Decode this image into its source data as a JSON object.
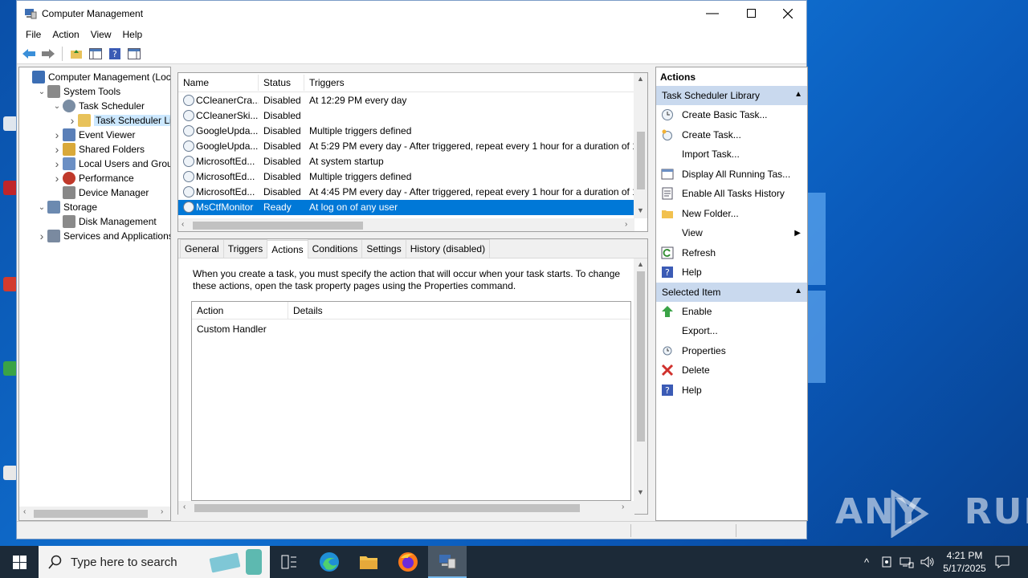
{
  "window": {
    "title": "Computer Management"
  },
  "menu": [
    "File",
    "Action",
    "View",
    "Help"
  ],
  "tree": [
    {
      "label": "Computer Management (Local",
      "icon": "computer-management-icon",
      "exp": "",
      "indent": 0
    },
    {
      "label": "System Tools",
      "icon": "tools-icon",
      "exp": "v",
      "indent": 1
    },
    {
      "label": "Task Scheduler",
      "icon": "clock-icon",
      "exp": "v",
      "indent": 2
    },
    {
      "label": "Task Scheduler Libra",
      "icon": "folder-clock-icon",
      "exp": ">",
      "indent": 3,
      "selected": true
    },
    {
      "label": "Event Viewer",
      "icon": "event-viewer-icon",
      "exp": ">",
      "indent": 2
    },
    {
      "label": "Shared Folders",
      "icon": "shared-folders-icon",
      "exp": ">",
      "indent": 2
    },
    {
      "label": "Local Users and Groups",
      "icon": "users-icon",
      "exp": ">",
      "indent": 2
    },
    {
      "label": "Performance",
      "icon": "performance-icon",
      "exp": ">",
      "indent": 2
    },
    {
      "label": "Device Manager",
      "icon": "device-manager-icon",
      "exp": "",
      "indent": 2
    },
    {
      "label": "Storage",
      "icon": "storage-icon",
      "exp": "v",
      "indent": 1
    },
    {
      "label": "Disk Management",
      "icon": "disk-icon",
      "exp": "",
      "indent": 2
    },
    {
      "label": "Services and Applications",
      "icon": "services-icon",
      "exp": ">",
      "indent": 1
    }
  ],
  "task_list": {
    "columns": [
      "Name",
      "Status",
      "Triggers"
    ],
    "rows": [
      {
        "name": "CCleanerCra...",
        "status": "Disabled",
        "triggers": "At 12:29 PM every day"
      },
      {
        "name": "CCleanerSki...",
        "status": "Disabled",
        "triggers": ""
      },
      {
        "name": "GoogleUpda...",
        "status": "Disabled",
        "triggers": "Multiple triggers defined"
      },
      {
        "name": "GoogleUpda...",
        "status": "Disabled",
        "triggers": "At 5:29 PM every day - After triggered, repeat every 1 hour for a duration of 1"
      },
      {
        "name": "MicrosoftEd...",
        "status": "Disabled",
        "triggers": "At system startup"
      },
      {
        "name": "MicrosoftEd...",
        "status": "Disabled",
        "triggers": "Multiple triggers defined"
      },
      {
        "name": "MicrosoftEd...",
        "status": "Disabled",
        "triggers": "At 4:45 PM every day - After triggered, repeat every 1 hour for a duration of 1"
      },
      {
        "name": "MsCtfMonitor",
        "status": "Ready",
        "triggers": "At log on of any user",
        "selected": true
      }
    ]
  },
  "detail": {
    "tabs": [
      "General",
      "Triggers",
      "Actions",
      "Conditions",
      "Settings",
      "History (disabled)"
    ],
    "active_tab": "Actions",
    "description": "When you create a task, you must specify the action that will occur when your task starts.  To change these actions, open the task property pages using the Properties command.",
    "columns": [
      "Action",
      "Details"
    ],
    "rows": [
      {
        "action": "Custom Handler",
        "details": ""
      }
    ]
  },
  "actions_pane": {
    "title": "Actions",
    "section1": {
      "header": "Task Scheduler Library",
      "items": [
        {
          "label": "Create Basic Task...",
          "icon": "create-basic-task-icon"
        },
        {
          "label": "Create Task...",
          "icon": "create-task-icon"
        },
        {
          "label": "Import Task...",
          "icon": ""
        },
        {
          "label": "Display All Running Tas...",
          "icon": "running-tasks-icon"
        },
        {
          "label": "Enable All Tasks History",
          "icon": "history-icon"
        },
        {
          "label": "New Folder...",
          "icon": "new-folder-icon"
        },
        {
          "label": "View",
          "icon": "",
          "submenu": true
        },
        {
          "label": "Refresh",
          "icon": "refresh-icon"
        },
        {
          "label": "Help",
          "icon": "help-icon"
        }
      ]
    },
    "section2": {
      "header": "Selected Item",
      "items": [
        {
          "label": "Enable",
          "icon": "enable-icon"
        },
        {
          "label": "Export...",
          "icon": ""
        },
        {
          "label": "Properties",
          "icon": "properties-icon"
        },
        {
          "label": "Delete",
          "icon": "delete-icon"
        },
        {
          "label": "Help",
          "icon": "help-icon"
        }
      ]
    }
  },
  "taskbar": {
    "search_placeholder": "Type here to search",
    "time": "4:21 PM",
    "date": "5/17/2025"
  },
  "watermark": "ANY RUN"
}
